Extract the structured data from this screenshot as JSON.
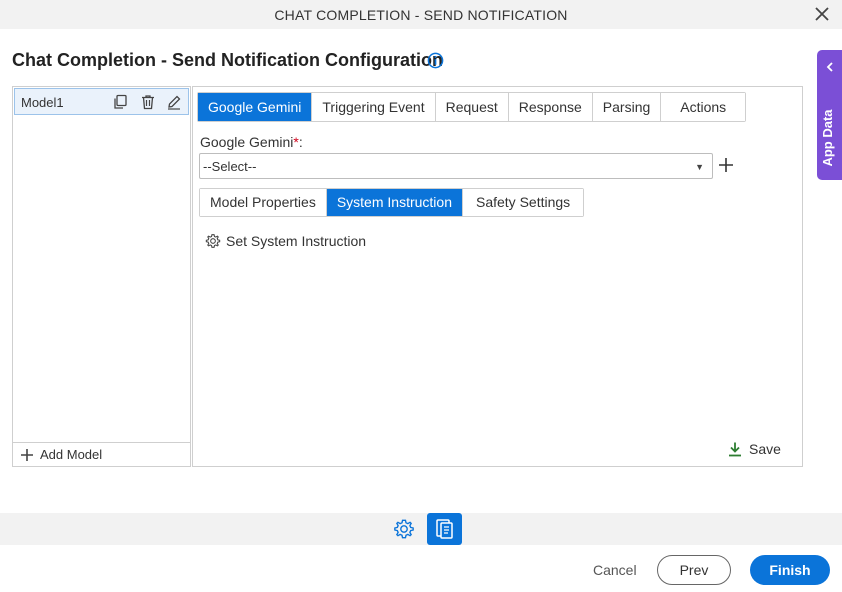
{
  "window": {
    "title": "CHAT COMPLETION - SEND NOTIFICATION",
    "close_icon": "close-icon"
  },
  "header": {
    "title": "Chat Completion - Send Notification Configuration",
    "info_icon": "info-icon"
  },
  "app_data": {
    "label": "App Data",
    "color": "#7b4fd6"
  },
  "models": {
    "items": [
      {
        "label": "Model1"
      }
    ],
    "add_label": "Add Model"
  },
  "tabs": [
    {
      "label": "Google Gemini",
      "active": true
    },
    {
      "label": "Triggering Event",
      "active": false
    },
    {
      "label": "Request",
      "active": false
    },
    {
      "label": "Response",
      "active": false
    },
    {
      "label": "Parsing",
      "active": false
    },
    {
      "label": "Actions",
      "active": false
    }
  ],
  "gemini_field": {
    "label": "Google Gemini",
    "required_marker": "*",
    "label_suffix": ":",
    "value": "--Select--"
  },
  "subtabs": [
    {
      "label": "Model Properties",
      "active": false
    },
    {
      "label": "System Instruction",
      "active": true
    },
    {
      "label": "Safety Settings",
      "active": false
    }
  ],
  "system_instruction": {
    "link_label": "Set System Instruction"
  },
  "save": {
    "label": "Save"
  },
  "footer": {
    "cancel_label": "Cancel",
    "prev_label": "Prev",
    "finish_label": "Finish"
  },
  "colors": {
    "accent": "#0b74d9",
    "save_icon": "#2e7d32",
    "required": "#d0021b"
  }
}
